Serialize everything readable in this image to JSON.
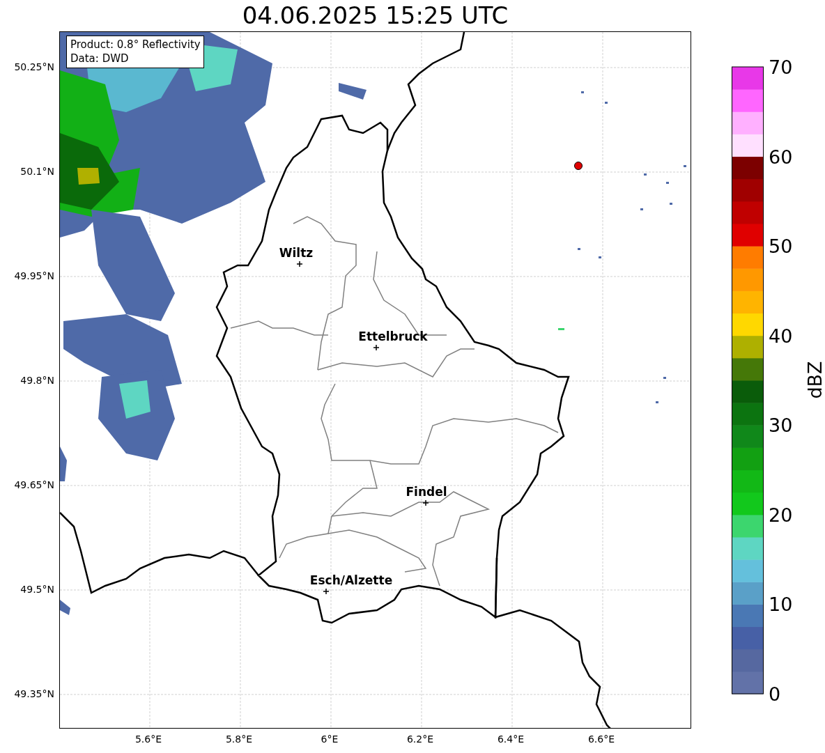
{
  "title": "04.06.2025 15:25 UTC",
  "info_box": [
    "Product: 0.8° Reflectivity",
    "Data: DWD"
  ],
  "cities": [
    "Wiltz",
    "Ettelbruck",
    "Findel",
    "Esch/Alzette"
  ],
  "x_ticks": [
    "5.6°E",
    "5.8°E",
    "6°E",
    "6.2°E",
    "6.4°E",
    "6.6°E"
  ],
  "y_ticks": [
    "50.25°N",
    "50.1°N",
    "49.95°N",
    "49.8°N",
    "49.65°N",
    "49.5°N",
    "49.35°N"
  ],
  "colorbar": {
    "label": "dBZ",
    "ticks": [
      "70",
      "60",
      "50",
      "40",
      "30",
      "20",
      "10",
      "0"
    ]
  }
}
